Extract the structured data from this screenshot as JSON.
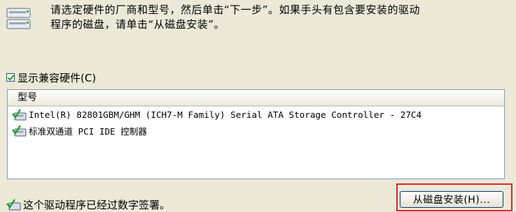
{
  "header": {
    "instructions": "请选定硬件的厂商和型号，然后单击“下一步”。如果手头有包含要安装的驱动\n程序的磁盘，请单击“从磁盘安装”。",
    "icon": "hardware-device-icon"
  },
  "show_compatible": {
    "label": "显示兼容硬件(C)",
    "checked": true
  },
  "model_list": {
    "column_header": "型号",
    "items": [
      {
        "label": "Intel(R) 82801GBM/GHM (ICH7-M Family) Serial ATA Storage Controller - 27C4",
        "icon": "signed-driver-icon"
      },
      {
        "label": "标准双通道 PCI IDE 控制器",
        "icon": "signed-driver-icon"
      }
    ]
  },
  "driver_signed": {
    "label": "这个驱动程序已经过数字签署。",
    "icon": "signed-driver-icon"
  },
  "buttons": {
    "have_disk": "从磁盘安装(H)..."
  },
  "colors": {
    "dialog_bg": "#ece9d8",
    "highlight_border": "#d42a2a",
    "list_border": "#7f9db9"
  }
}
